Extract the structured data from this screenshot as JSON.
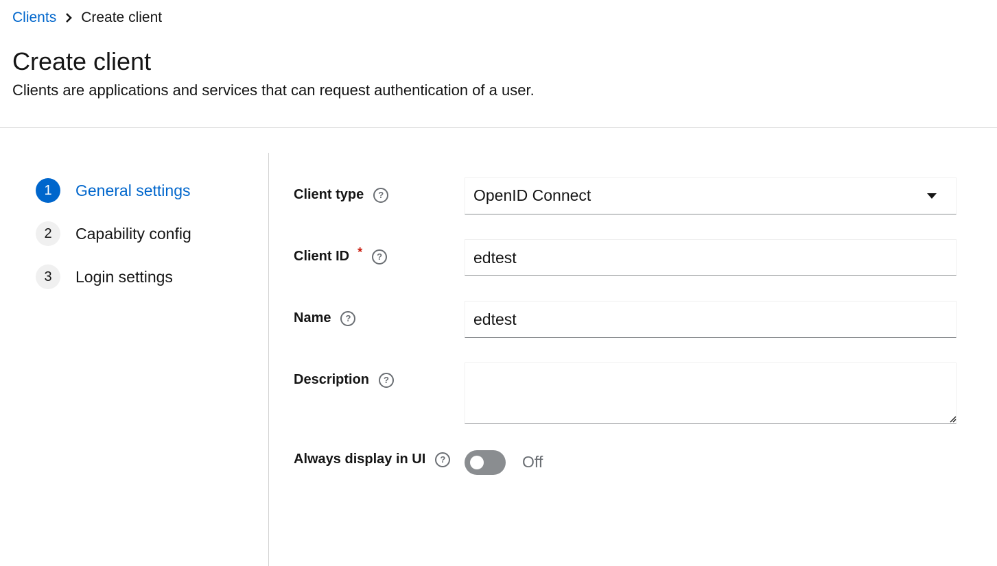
{
  "breadcrumb": {
    "parent": "Clients",
    "current": "Create client"
  },
  "header": {
    "title": "Create client",
    "description": "Clients are applications and services that can request authentication of a user."
  },
  "wizard": {
    "steps": [
      {
        "number": "1",
        "label": "General settings",
        "active": true
      },
      {
        "number": "2",
        "label": "Capability config",
        "active": false
      },
      {
        "number": "3",
        "label": "Login settings",
        "active": false
      }
    ]
  },
  "form": {
    "client_type": {
      "label": "Client type",
      "value": "OpenID Connect"
    },
    "client_id": {
      "label": "Client ID",
      "required_marker": "*",
      "value": "edtest"
    },
    "name": {
      "label": "Name",
      "value": "edtest"
    },
    "description": {
      "label": "Description",
      "value": ""
    },
    "always_display": {
      "label": "Always display in UI",
      "state_text": "Off",
      "on": false
    }
  },
  "icons": {
    "breadcrumb_separator": "chevron-right-icon",
    "help": "question-circle-icon",
    "dropdown": "caret-down-icon"
  },
  "colors": {
    "accent": "#0066cc",
    "required": "#c9190b",
    "toggle_off": "#8a8d90"
  }
}
